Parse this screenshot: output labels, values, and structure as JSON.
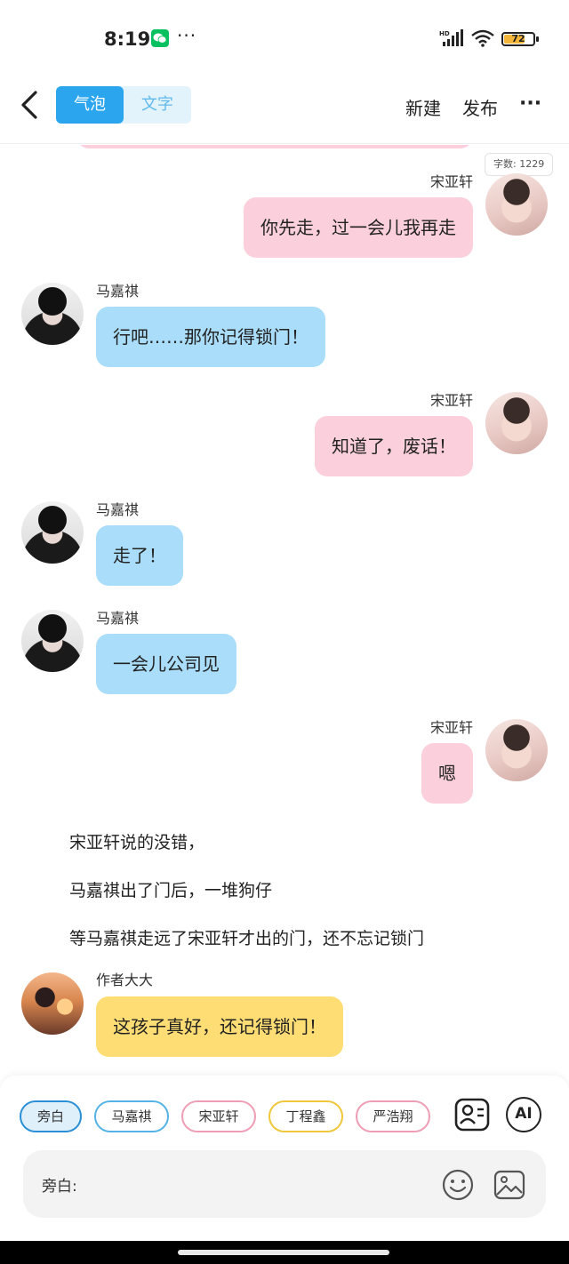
{
  "status_bar": {
    "time": "8:19",
    "more": "···",
    "battery_level": "72",
    "battery_color": "#f4b63a"
  },
  "top_bar": {
    "tabs": [
      {
        "label": "气泡",
        "active": true
      },
      {
        "label": "文字",
        "active": false
      }
    ],
    "new_label": "新建",
    "publish_label": "发布",
    "more": "···"
  },
  "chat": {
    "word_count": "字数: 1229",
    "messages": [
      {
        "speaker": "宋亚轩",
        "side": "right",
        "text": "你先走，过一会儿我再走"
      },
      {
        "speaker": "马嘉祺",
        "side": "left",
        "text": "行吧……那你记得锁门！"
      },
      {
        "speaker": "宋亚轩",
        "side": "right",
        "text": "知道了，废话！"
      },
      {
        "speaker": "马嘉祺",
        "side": "left",
        "text": "走了！"
      },
      {
        "speaker": "马嘉祺",
        "side": "left",
        "text": "一会儿公司见"
      },
      {
        "speaker": "宋亚轩",
        "side": "right",
        "text": "嗯"
      }
    ],
    "narration": [
      "宋亚轩说的没错，",
      "马嘉祺出了门后，一堆狗仔",
      "等马嘉祺走远了宋亚轩才出的门，还不忘记锁门"
    ],
    "author_message": {
      "speaker": "作者大大",
      "text": "这孩子真好，还记得锁门！"
    }
  },
  "bottom_panel": {
    "roles": [
      "旁白",
      "马嘉祺",
      "宋亚轩",
      "丁程鑫",
      "严浩翔"
    ],
    "ai_label": "AI",
    "input_label": "旁白:",
    "input_value": ""
  },
  "colors": {
    "accent_blue": "#2aa5ee",
    "bubble_pink": "#fbd0dc",
    "bubble_blue": "#a9ddfa",
    "bubble_yellow": "#fedd75"
  }
}
